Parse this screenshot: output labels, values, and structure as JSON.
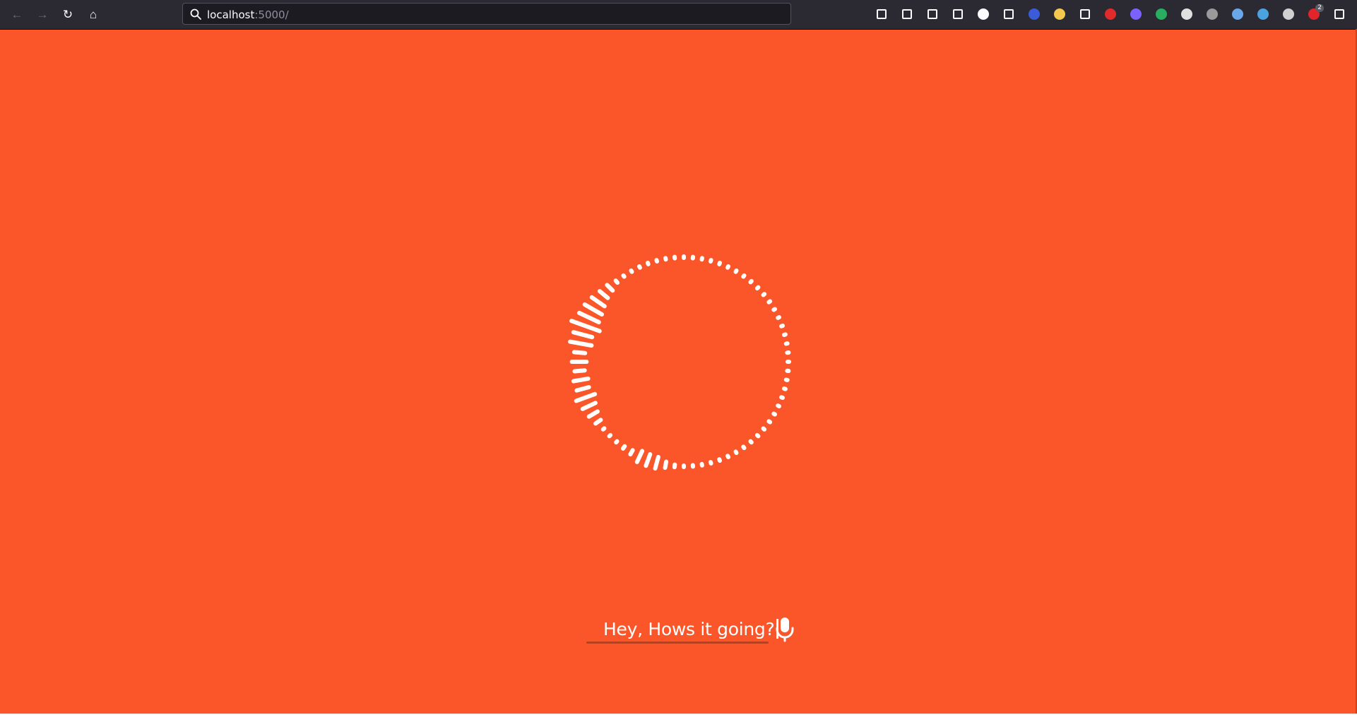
{
  "browser": {
    "url_host": "localhost",
    "url_port": ":5000/",
    "nav": [
      {
        "name": "back-icon",
        "glyph": "←",
        "enabled": false
      },
      {
        "name": "forward-icon",
        "glyph": "→",
        "enabled": false
      },
      {
        "name": "reload-icon",
        "glyph": "↻",
        "enabled": true
      },
      {
        "name": "home-icon",
        "glyph": "⌂",
        "enabled": true
      }
    ],
    "extensions": [
      {
        "name": "pocket-icon",
        "color": "#fbfbfe"
      },
      {
        "name": "downloads-icon",
        "color": "#fbfbfe"
      },
      {
        "name": "library-icon",
        "color": "#fbfbfe"
      },
      {
        "name": "sidebar-icon",
        "color": "#fbfbfe"
      },
      {
        "name": "extension-m-icon",
        "color": "#fbfbfe"
      },
      {
        "name": "crop-icon",
        "color": "#fbfbfe"
      },
      {
        "name": "globe-extension-icon",
        "color": "#3b5bd9"
      },
      {
        "name": "glasses-extension-icon",
        "color": "#f2c94c"
      },
      {
        "name": "fast-forward-icon",
        "color": "#fbfbfe"
      },
      {
        "name": "red-extension-icon",
        "color": "#e02b2b"
      },
      {
        "name": "purple-extension-icon",
        "color": "#7b61ff"
      },
      {
        "name": "green-extension-icon",
        "color": "#27ae60"
      },
      {
        "name": "s-extension-icon",
        "color": "#e0e0e0"
      },
      {
        "name": "info-extension-icon",
        "color": "#9a9a9a"
      },
      {
        "name": "bottle-extension-icon",
        "color": "#6aa7e8"
      },
      {
        "name": "face-extension-icon",
        "color": "#4aa3df"
      },
      {
        "name": "pen-extension-icon",
        "color": "#d0d0d0"
      },
      {
        "name": "adblock-icon",
        "color": "#e3242b"
      },
      {
        "name": "menu-icon",
        "color": "#fbfbfe"
      }
    ],
    "adblock_badge": "2"
  },
  "assistant": {
    "prompt_text": "Hey, Hows it going?",
    "mic_icon": "microphone-icon",
    "background_color": "#fb5629",
    "accent_color": "#ffffff"
  }
}
